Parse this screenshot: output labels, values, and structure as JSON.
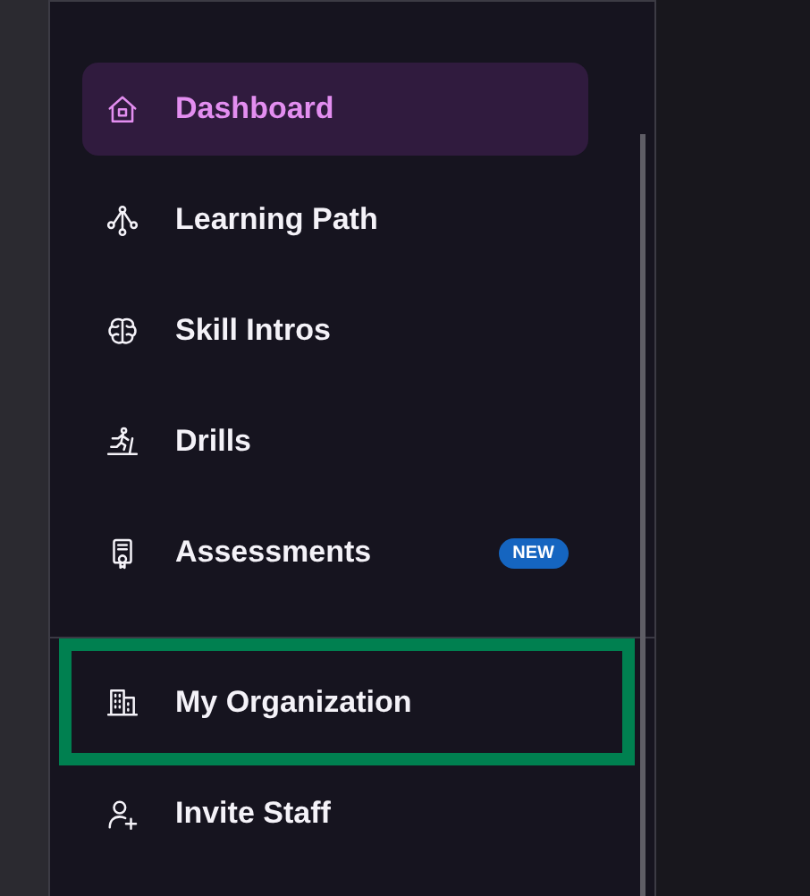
{
  "sidebar": {
    "sections": [
      {
        "items": [
          {
            "label": "Dashboard",
            "kind": "home",
            "selected": true,
            "highlighted": false
          },
          {
            "label": "Learning Path",
            "kind": "path",
            "selected": false,
            "highlighted": false
          },
          {
            "label": "Skill Intros",
            "kind": "brain",
            "selected": false,
            "highlighted": false
          },
          {
            "label": "Drills",
            "kind": "treadmill",
            "selected": false,
            "highlighted": false
          },
          {
            "label": "Assessments",
            "kind": "certificate",
            "selected": false,
            "highlighted": false,
            "badge": "NEW"
          }
        ]
      },
      {
        "items": [
          {
            "label": "My Organization",
            "kind": "building",
            "selected": false,
            "highlighted": true
          },
          {
            "label": "Invite Staff",
            "kind": "user",
            "selected": false,
            "highlighted": false
          }
        ]
      }
    ]
  }
}
